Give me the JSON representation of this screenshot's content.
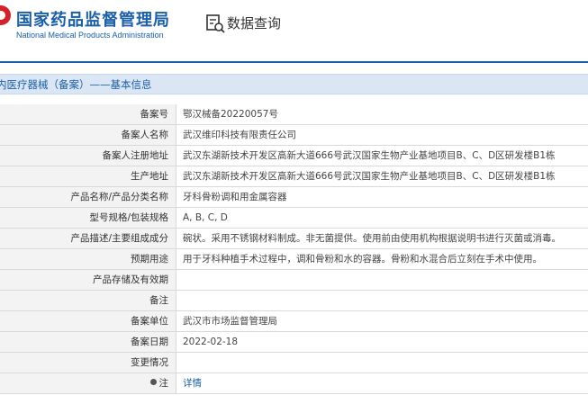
{
  "header": {
    "brand_cn": "国家药品监督管理局",
    "brand_en": "National Medical Products Administration",
    "query_label": "数据查询"
  },
  "section": {
    "title": "内医疗器械（备案）——基本信息"
  },
  "rows": [
    {
      "label": "备案号",
      "value": "鄂汉械备20220057号"
    },
    {
      "label": "备案人名称",
      "value": "武汉维印科技有限责任公司"
    },
    {
      "label": "备案人注册地址",
      "value": "武汉东湖新技术开发区高新大道666号武汉国家生物产业基地项目B、C、D区研发楼B1栋"
    },
    {
      "label": "生产地址",
      "value": "武汉东湖新技术开发区高新大道666号武汉国家生物产业基地项目B、C、D区研发楼B1栋"
    },
    {
      "label": "产品名称/产品分类名称",
      "value": "牙科骨粉调和用金属容器"
    },
    {
      "label": "型号规格/包装规格",
      "value": "A, B, C, D"
    },
    {
      "label": "产品描述/主要组成成分",
      "value": "碗状。采用不锈钢材料制成。非无菌提供。使用前由使用机构根据说明书进行灭菌或消毒。"
    },
    {
      "label": "预期用途",
      "value": "用于牙科种植手术过程中，调和骨粉和水的容器。骨粉和水混合后立刻在手术中使用。"
    },
    {
      "label": "产品存储及有效期",
      "value": ""
    },
    {
      "label": "备注",
      "value": ""
    },
    {
      "label": "备案单位",
      "value": "武汉市市场监督管理局"
    },
    {
      "label": "备案日期",
      "value": "2022-02-18"
    },
    {
      "label": "变更情况",
      "value": ""
    },
    {
      "label": "注",
      "value": "详情"
    }
  ]
}
